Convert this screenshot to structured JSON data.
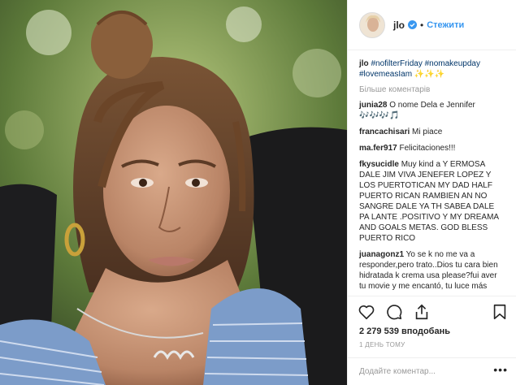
{
  "post": {
    "username": "jlo",
    "follow_label": "Стежити",
    "separator": "•"
  },
  "caption": {
    "username": "jlo",
    "tags": "#nofilterFriday #nomakeupday #lovemeasIam",
    "emoji": "✨✨✨"
  },
  "more_comments_label": "Більше коментарів",
  "comments": [
    {
      "user": "junia28",
      "text": "O nome Dela e Jennifer 🎶🎶🎶🎵"
    },
    {
      "user": "francachisari",
      "text": "Mi piace"
    },
    {
      "user": "ma.fer917",
      "text": "Felicitaciones!!!"
    },
    {
      "user": "fkysucidle",
      "text": "Muy kind a Y ERMOSA DALE JIM VIVA JENEFER LOPEZ Y LOS PUERTOTICAN MY DAD HALF PUERTO RICAN RAMBIEN AN NO SANGRE DALE YA TH SABEA DALE PA LANTE .POSITIVO Y MY DREAMA AND GOALS METAS. GOD BLESS PUERTO RICO"
    },
    {
      "user": "juanagonz1",
      "text": "Yo se k no me va a responder,pero trato..Dios tu cara bien hidratada k crema usa please?fui aver tu movie y me encantó, tu luce más"
    }
  ],
  "likes_text": "2 279 539 вподобань",
  "time_text": "1 ДЕНЬ ТОМУ",
  "comment_input": {
    "placeholder": "Додайте коментар..."
  },
  "more_options": "•••",
  "icons": [
    "verified-icon",
    "heart-icon",
    "comment-icon",
    "share-icon",
    "bookmark-icon"
  ],
  "colors": {
    "link": "#3897f0",
    "hashtag": "#003569",
    "muted": "#999999",
    "text": "#262626"
  }
}
